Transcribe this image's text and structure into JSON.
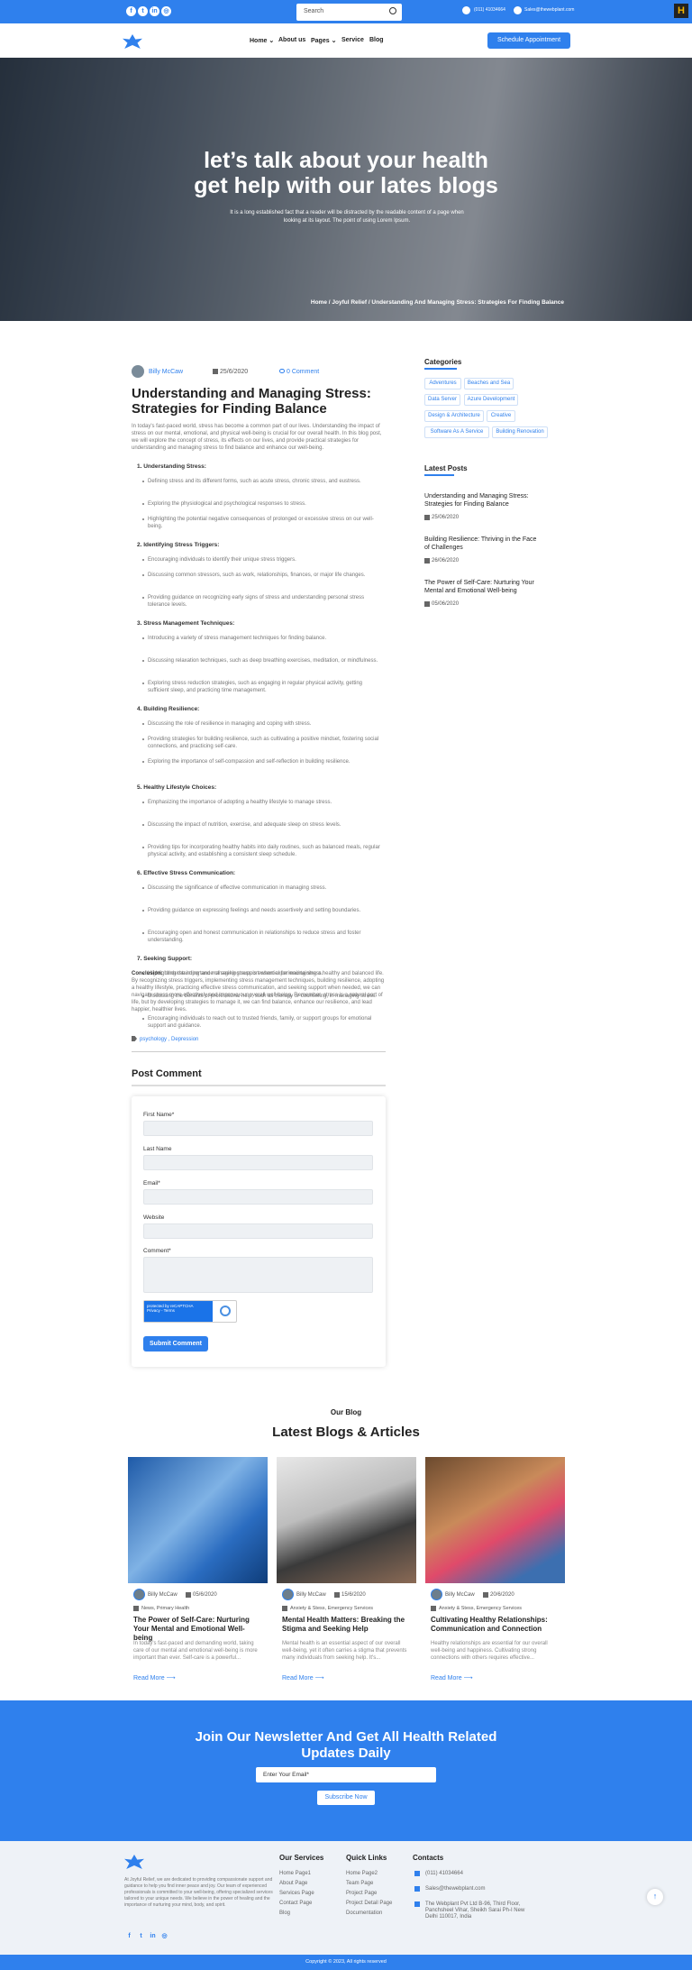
{
  "topbar": {
    "social": [
      "f",
      "t",
      "in",
      "◎"
    ],
    "search_placeholder": "Search",
    "phone": "(011) 41034664",
    "email": "Sales@thewebplant.com"
  },
  "nav": {
    "items": [
      "Home ⌄",
      "About us",
      "Pages ⌄",
      "Service",
      "Blog"
    ],
    "cta": "Schedule Appointment"
  },
  "hero": {
    "line1": "let’s talk about your health",
    "line2": "get help with our lates blogs",
    "sub": "It is a long established fact that a reader will be distracted by the readable content of a page when looking at its layout. The point of using Lorem Ipsum.",
    "crumb": "Home / Joyful Relief / Understanding And Managing Stress: Strategies For Finding Balance"
  },
  "post": {
    "author": "Billy McCaw",
    "date": "25/6/2020",
    "comments": "0 Comment",
    "title": "Understanding and Managing Stress: Strategies for Finding Balance",
    "intro": "In today's fast-paced world, stress has become a common part of our lives. Understanding the impact of stress on our mental, emotional, and physical well-being is crucial for our overall health. In this blog post, we will explore the concept of stress, its effects on our lives, and provide practical strategies for understanding and managing stress to find balance and enhance our well-being.",
    "sections": [
      {
        "h": "1. Understanding Stress:",
        "items": [
          "Defining stress and its different forms, such as acute stress, chronic stress, and eustress.",
          "Exploring the physiological and psychological responses to stress.",
          "Highlighting the potential negative consequences of prolonged or excessive stress on our well-being."
        ]
      },
      {
        "h": "2. Identifying Stress Triggers:",
        "items": [
          "Encouraging individuals to identify their unique stress triggers.",
          "Discussing common stressors, such as work, relationships, finances, or major life changes.",
          "Providing guidance on recognizing early signs of stress and understanding personal stress tolerance levels."
        ]
      },
      {
        "h": "3. Stress Management Techniques:",
        "items": [
          "Introducing a variety of stress management techniques for finding balance.",
          "Discussing relaxation techniques, such as deep breathing exercises, meditation, or mindfulness.",
          "Exploring stress reduction strategies, such as engaging in regular physical activity, getting sufficient sleep, and practicing time management."
        ]
      },
      {
        "h": "4. Building Resilience:",
        "items": [
          "Discussing the role of resilience in managing and coping with stress.",
          "Providing strategies for building resilience, such as cultivating a positive mindset, fostering social connections, and practicing self-care.",
          "Exploring the importance of self-compassion and self-reflection in building resilience."
        ]
      },
      {
        "h": "5. Healthy Lifestyle Choices:",
        "items": [
          "Emphasizing the importance of adopting a healthy lifestyle to manage stress.",
          "Discussing the impact of nutrition, exercise, and adequate sleep on stress levels.",
          "Providing tips for incorporating healthy habits into daily routines, such as balanced meals, regular physical activity, and establishing a consistent sleep schedule."
        ]
      },
      {
        "h": "6. Effective Stress Communication:",
        "items": [
          "Discussing the significance of effective communication in managing stress.",
          "Providing guidance on expressing feelings and needs assertively and setting boundaries.",
          "Encouraging open and honest communication in relationships to reduce stress and foster understanding."
        ]
      },
      {
        "h": "7. Seeking Support:",
        "items": [
          "Highlighting the importance of seeking support when experiencing stress.",
          "Discussing the benefits of professional help, such as therapy or counseling, in managing stress.",
          "Encouraging individuals to reach out to trusted friends, family, or support groups for emotional support and guidance."
        ]
      }
    ],
    "conclusion_label": "Conclusion:",
    "conclusion": " Understanding and managing stress is essential for maintaining a healthy and balanced life. By recognizing stress triggers, implementing stress management techniques, building resilience, adopting a healthy lifestyle, practicing effective stress communication, and seeking support when needed, we can navigate stress more effectively and improve our overall well-being. Remember, stress is a natural part of life, but by developing strategies to manage it, we can find balance, enhance our resilience, and lead happier, healthier lives.",
    "tags": "psychology , Depression"
  },
  "comment": {
    "heading": "Post Comment",
    "labels": [
      "First Name*",
      "Last Name",
      "Email*",
      "Website",
      "Comment*"
    ],
    "captcha": "protected by reCAPTCHA",
    "captcha_sub": "Privacy - Terms",
    "submit": "Submit Comment"
  },
  "sidebar": {
    "cat_heading": "Categories",
    "cats": [
      "Adventures",
      "Beaches and Sea",
      "Data Server",
      "Azure Development",
      "Design & Architecture",
      "Creative",
      "Software As A Service",
      "Building Renovation"
    ],
    "latest_heading": "Latest Posts",
    "posts": [
      {
        "t": "Understanding and Managing Stress: Strategies for Finding Balance",
        "d": "25/06/2020"
      },
      {
        "t": "Building Resilience: Thriving in the Face of Challenges",
        "d": "26/06/2020"
      },
      {
        "t": "The Power of Self-Care: Nurturing Your Mental and Emotional Well-being",
        "d": "05/06/2020"
      }
    ]
  },
  "blog": {
    "kicker": "Our Blog",
    "heading": "Latest Blogs & Articles",
    "cards": [
      {
        "author": "Billy McCaw",
        "date": "05/6/2020",
        "cats": "News, Primary Health",
        "title": "The Power of Self-Care: Nurturing Your Mental and Emotional Well-being",
        "text": "In today's fast-paced and demanding world, taking care of our mental and emotional well-being is more important than ever. Self-care is a powerful...",
        "more": "Read More"
      },
      {
        "author": "Billy McCaw",
        "date": "15/6/2020",
        "cats": "Anxiety & Stess, Emergency Services",
        "title": "Mental Health Matters: Breaking the Stigma and Seeking Help",
        "text": "Mental health is an essential aspect of our overall well-being, yet it often carries a stigma that prevents many individuals from seeking help. It's...",
        "more": "Read More"
      },
      {
        "author": "Billy McCaw",
        "date": "20/6/2020",
        "cats": "Anxiety & Stess, Emergency Services",
        "title": "Cultivating Healthy Relationships: Communication and Connection",
        "text": "Healthy relationships are essential for our overall well-being and happiness. Cultivating strong connections with others requires effective...",
        "more": "Read More"
      }
    ]
  },
  "newsletter": {
    "line1": "Join Our Newsletter And Get All Health Related",
    "line2": "Updates Daily",
    "placeholder": "Enter Your Email*",
    "button": "Subscribe Now"
  },
  "footer": {
    "about": "At Joyful Relief, we are dedicated to providing compassionate support and guidance to help you find inner peace and joy. Our team of experienced professionals is committed to your well-being, offering specialized services tailored to your unique needs. We believe in the power of healing and the importance of nurturing your mind, body, and spirit.",
    "services_heading": "Our Services",
    "services": [
      "Home Page1",
      "About Page",
      "Services Page",
      "Contact Page",
      "Blog"
    ],
    "links_heading": "Quick Links",
    "links": [
      "Home Page2",
      "Team Page",
      "Project Page",
      "Project Detail Page",
      "Documentation"
    ],
    "contacts_heading": "Contacts",
    "phone": "(011) 41034664",
    "email": "Sales@thewebplant.com",
    "address": "The Webplant Pvt Ltd B-96, Third Floor, Panchsheel Vihar, Sheikh Sarai Ph-I New Delhi 110017, India",
    "social": [
      "f",
      "t",
      "in",
      "◎"
    ],
    "copyright": "Copyright © 2023, All rights reserved"
  },
  "colors": {
    "accent": "#2f80ed"
  }
}
